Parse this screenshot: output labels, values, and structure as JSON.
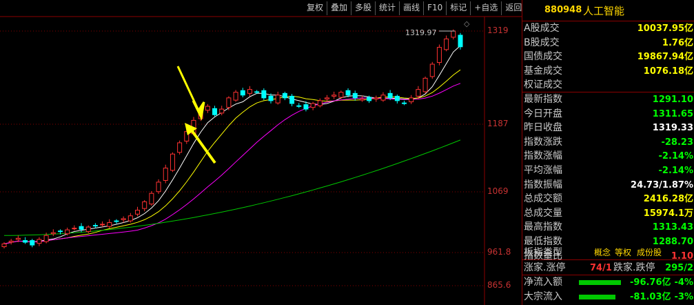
{
  "toolbar": [
    "复权",
    "叠加",
    "多股",
    "统计",
    "画线",
    "F10",
    "标记",
    "+自选",
    "返回"
  ],
  "chart": {
    "y_ticks": [
      "1319",
      "1187",
      "1069",
      "961.8",
      "865.6"
    ],
    "high_label": "1319.97",
    "colors": {
      "up": "#ff3232",
      "down": "#00ffff",
      "ma5": "#ffffff",
      "ma10": "#ffff00",
      "ma20": "#ff00ff",
      "ma60": "#00c800",
      "grid": "#8b0000"
    }
  },
  "panel": {
    "code": "880948",
    "name": "人工智能",
    "rows": [
      {
        "label": "A股成交",
        "value": "10037.95亿",
        "color": "#ffff00"
      },
      {
        "label": "B股成交",
        "value": "1.76亿",
        "color": "#ffff00"
      },
      {
        "label": "国债成交",
        "value": "19867.94亿",
        "color": "#ffff00"
      },
      {
        "label": "基金成交",
        "value": "1076.18亿",
        "color": "#ffff00"
      },
      {
        "label": "权证成交",
        "value": "",
        "color": "#ffff00"
      },
      {
        "label": "最新指数",
        "value": "1291.10",
        "color": "#00ff00"
      },
      {
        "label": "今日开盘",
        "value": "1311.65",
        "color": "#00ff00"
      },
      {
        "label": "昨日收盘",
        "value": "1319.33",
        "color": "#ffffff"
      },
      {
        "label": "指数涨跌",
        "value": "-28.23",
        "color": "#00ff00"
      },
      {
        "label": "指数涨幅",
        "value": "-2.14%",
        "color": "#00ff00"
      },
      {
        "label": "平均涨幅",
        "value": "-2.14%",
        "color": "#00ff00"
      },
      {
        "label": "指数振幅",
        "value": "24.73/1.87%",
        "color": "#ffffff"
      },
      {
        "label": "总成交额",
        "value": "2416.28亿",
        "color": "#ffff00"
      },
      {
        "label": "总成交量",
        "value": "15974.1万",
        "color": "#ffff00"
      },
      {
        "label": "最高指数",
        "value": "1313.43",
        "color": "#00ff00"
      },
      {
        "label": "最低指数",
        "value": "1288.70",
        "color": "#00ff00"
      },
      {
        "label": "指数量比",
        "value": "1.10",
        "color": "#ff3232"
      }
    ],
    "board_type": {
      "label": "板指类型",
      "values": [
        "概念",
        "等权",
        "成份股"
      ]
    },
    "stats": {
      "up_label": "涨家.涨停",
      "up_value": "74/1",
      "down_label": "跌家.跌停",
      "down_value": "295/2"
    },
    "flows": [
      {
        "label": "净流入额",
        "value": "-96.76亿",
        "pct": "-4%",
        "fraction": 0.9
      },
      {
        "label": "大宗流入",
        "value": "-81.03亿",
        "pct": "-3%",
        "fraction": 0.78
      }
    ]
  }
}
